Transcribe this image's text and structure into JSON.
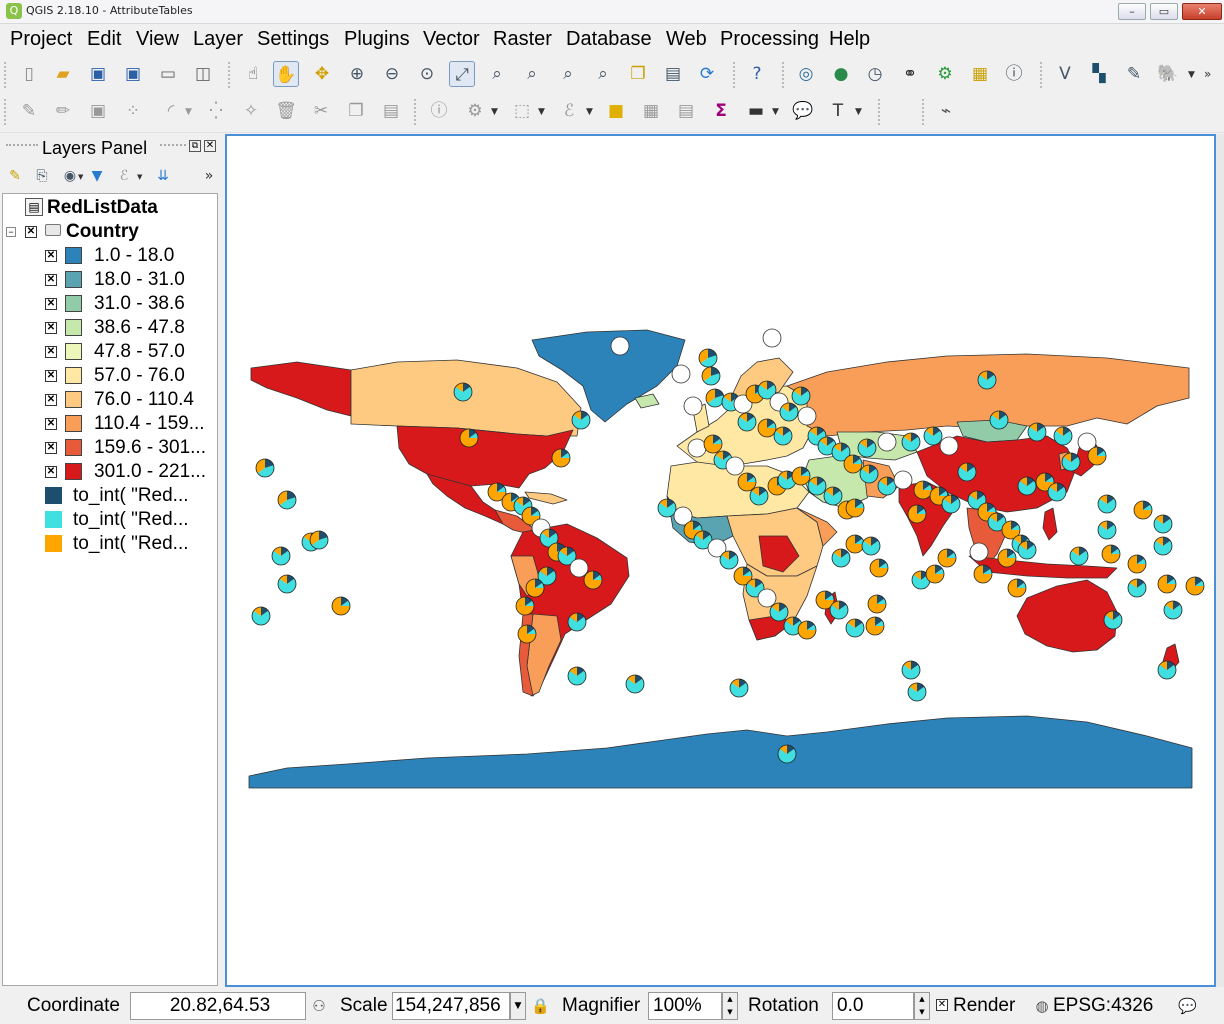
{
  "window": {
    "title": "QGIS 2.18.10 - AttributeTables",
    "min": "–",
    "max": "▭",
    "close": "✕"
  },
  "menubar": [
    "Project",
    "Edit",
    "View",
    "Layer",
    "Settings",
    "Plugins",
    "Vector",
    "Raster",
    "Database",
    "Web",
    "Processing",
    "Help"
  ],
  "layers_panel": {
    "title": "Layers Panel",
    "tree": [
      {
        "label": "RedListData",
        "bold": true,
        "kind": "table"
      },
      {
        "label": "Country",
        "bold": true,
        "kind": "group",
        "checked": true
      },
      {
        "label": "1.0 - 18.0",
        "color": "#2b83ba",
        "checked": true
      },
      {
        "label": "18.0 - 31.0",
        "color": "#5aa4b1",
        "checked": true
      },
      {
        "label": "31.0 - 38.6",
        "color": "#91cba8",
        "checked": true
      },
      {
        "label": "38.6 - 47.8",
        "color": "#c7e8ad",
        "checked": true
      },
      {
        "label": "47.8 - 57.0",
        "color": "#ecf7b9",
        "checked": true
      },
      {
        "label": "57.0 - 76.0",
        "color": "#fee8a4",
        "checked": true
      },
      {
        "label": "76.0 - 110.4",
        "color": "#fec980",
        "checked": true
      },
      {
        "label": "110.4 - 159...",
        "color": "#f99e59",
        "checked": true
      },
      {
        "label": "159.6 - 301...",
        "color": "#e85b3a",
        "checked": true
      },
      {
        "label": "301.0 - 221...",
        "color": "#d7191c",
        "checked": true
      },
      {
        "label": "to_int(  \"Red...",
        "color": "#1d4e6e",
        "checked": false
      },
      {
        "label": "to_int(  \"Red...",
        "color": "#40e0e0",
        "checked": false
      },
      {
        "label": "to_int(  \"Red...",
        "color": "#ffa500",
        "checked": false
      }
    ]
  },
  "statusbar": {
    "coordinate_label": "Coordinate",
    "coordinate_value": "20.82,64.53",
    "scale_label": "Scale",
    "scale_value": "154,247,856",
    "magnifier_label": "Magnifier",
    "magnifier_value": "100%",
    "rotation_label": "Rotation",
    "rotation_value": "0.0",
    "render_label": "Render",
    "crs": "EPSG:4326"
  },
  "colors": {
    "pie_dark": "#1d4e6e",
    "pie_cyan": "#40e0e0",
    "pie_orange": "#ffa500",
    "antarctica": "#2b83ba",
    "ocean": "#ffffff"
  }
}
